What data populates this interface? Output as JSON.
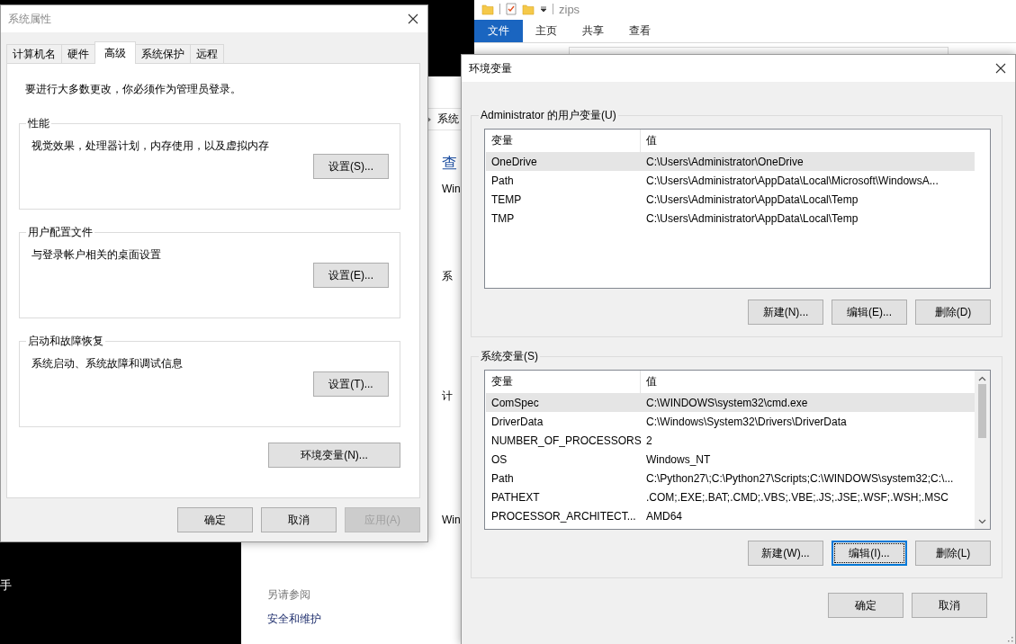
{
  "desktop": {
    "terminal_text": "手"
  },
  "explorer": {
    "title": "zips",
    "ribbon_tabs": [
      {
        "label": "文件",
        "selected": true
      },
      {
        "label": "主页",
        "selected": false
      },
      {
        "label": "共享",
        "selected": false
      },
      {
        "label": "查看",
        "selected": false
      }
    ]
  },
  "background_window": {
    "breadcrumb": "系统",
    "heading": "查",
    "labels": [
      "Win",
      "系",
      "计",
      "Win"
    ],
    "see_also": {
      "title": "另请参阅",
      "links": [
        "安全和维护"
      ]
    }
  },
  "system_properties": {
    "title": "系统属性",
    "tabs": [
      {
        "label": "计算机名",
        "selected": false
      },
      {
        "label": "硬件",
        "selected": false
      },
      {
        "label": "高级",
        "selected": true
      },
      {
        "label": "系统保护",
        "selected": false
      },
      {
        "label": "远程",
        "selected": false
      }
    ],
    "notice": "要进行大多数更改，你必须作为管理员登录。",
    "groups": [
      {
        "title": "性能",
        "description": "视觉效果，处理器计划，内存使用，以及虚拟内存",
        "button": "设置(S)..."
      },
      {
        "title": "用户配置文件",
        "description": "与登录帐户相关的桌面设置",
        "button": "设置(E)..."
      },
      {
        "title": "启动和故障恢复",
        "description": "系统启动、系统故障和调试信息",
        "button": "设置(T)..."
      }
    ],
    "env_button": "环境变量(N)...",
    "buttons": [
      {
        "label": "确定",
        "disabled": false
      },
      {
        "label": "取消",
        "disabled": false
      },
      {
        "label": "应用(A)",
        "disabled": true
      }
    ]
  },
  "environment_variables": {
    "title": "环境变量",
    "user_variables": {
      "title": "Administrator 的用户变量(U)",
      "columns": [
        "变量",
        "值"
      ],
      "rows": [
        {
          "name": "OneDrive",
          "value": "C:\\Users\\Administrator\\OneDrive",
          "selected": true
        },
        {
          "name": "Path",
          "value": "C:\\Users\\Administrator\\AppData\\Local\\Microsoft\\WindowsA...",
          "selected": false
        },
        {
          "name": "TEMP",
          "value": "C:\\Users\\Administrator\\AppData\\Local\\Temp",
          "selected": false
        },
        {
          "name": "TMP",
          "value": "C:\\Users\\Administrator\\AppData\\Local\\Temp",
          "selected": false
        }
      ],
      "buttons": [
        {
          "label": "新建(N)...",
          "focused": false
        },
        {
          "label": "编辑(E)...",
          "focused": false
        },
        {
          "label": "删除(D)",
          "focused": false
        }
      ]
    },
    "system_variables": {
      "title": "系统变量(S)",
      "columns": [
        "变量",
        "值"
      ],
      "rows": [
        {
          "name": "ComSpec",
          "value": "C:\\WINDOWS\\system32\\cmd.exe",
          "selected": true
        },
        {
          "name": "DriverData",
          "value": "C:\\Windows\\System32\\Drivers\\DriverData",
          "selected": false
        },
        {
          "name": "NUMBER_OF_PROCESSORS",
          "value": "2",
          "selected": false
        },
        {
          "name": "OS",
          "value": "Windows_NT",
          "selected": false
        },
        {
          "name": "Path",
          "value": "C:\\Python27\\;C:\\Python27\\Scripts;C:\\WINDOWS\\system32;C:\\...",
          "selected": false
        },
        {
          "name": "PATHEXT",
          "value": ".COM;.EXE;.BAT;.CMD;.VBS;.VBE;.JS;.JSE;.WSF;.WSH;.MSC",
          "selected": false
        },
        {
          "name": "PROCESSOR_ARCHITECT...",
          "value": "AMD64",
          "selected": false
        }
      ],
      "buttons": [
        {
          "label": "新建(W)...",
          "focused": false
        },
        {
          "label": "编辑(I)...",
          "focused": true
        },
        {
          "label": "删除(L)",
          "focused": false
        }
      ]
    },
    "buttons": [
      "确定",
      "取消"
    ]
  }
}
